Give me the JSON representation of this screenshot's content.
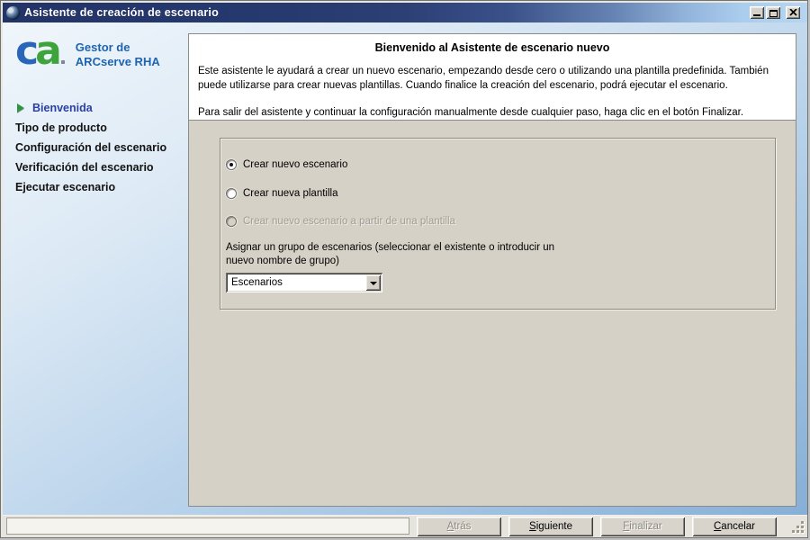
{
  "window": {
    "title": "Asistente de creación de escenario",
    "controls": {
      "minimize": "minimize",
      "maximize": "maximize",
      "close": "close"
    }
  },
  "sidebar": {
    "logo": {
      "mark_c": "c",
      "mark_a": "a",
      "product_line1": "Gestor de",
      "product_line2": "ARCserve RHA"
    },
    "steps": [
      {
        "label": "Bienvenida",
        "active": true
      },
      {
        "label": "Tipo de producto",
        "active": false
      },
      {
        "label": "Configuración del escenario",
        "active": false
      },
      {
        "label": "Verificación del escenario",
        "active": false
      },
      {
        "label": "Ejecutar escenario",
        "active": false
      }
    ]
  },
  "main": {
    "heading": "Bienvenido al Asistente de escenario nuevo",
    "intro": "Este asistente le ayudará a crear un nuevo escenario, empezando desde cero o utilizando una plantilla predefinida. También puede utilizarse para crear nuevas plantillas. Cuando finalice la creación del escenario, podrá ejecutar el escenario.",
    "finish_hint": "Para salir del asistente y continuar la configuración manualmente desde cualquier paso, haga clic en el botón Finalizar.",
    "options": [
      {
        "label": "Crear nuevo escenario",
        "selected": true,
        "enabled": true
      },
      {
        "label": "Crear nueva plantilla",
        "selected": false,
        "enabled": true
      },
      {
        "label": "Crear nuevo escenario a partir de una plantilla",
        "selected": false,
        "enabled": false
      }
    ],
    "group_label": "Asignar un grupo de escenarios (seleccionar el existente o introducir un nuevo nombre de grupo)",
    "group_combo_value": "Escenarios"
  },
  "footer": {
    "status_text": "",
    "buttons": [
      {
        "label": "Atrás",
        "enabled": false
      },
      {
        "label": "Siguiente",
        "enabled": true
      },
      {
        "label": "Finalizar",
        "enabled": false
      },
      {
        "label": "Cancelar",
        "enabled": true
      }
    ]
  },
  "colors": {
    "titlebar_left": "#223367",
    "titlebar_right": "#b5d5f1",
    "sidebar_top": "#f0f6fb",
    "sidebar_bottom": "#86afd7",
    "panel_tan": "#d5d1c6",
    "active_step": "#2a3fa4",
    "step_arrow_green": "#2f9440",
    "logo_blue": "#1e64ae",
    "logo_green": "#3fa33c"
  }
}
